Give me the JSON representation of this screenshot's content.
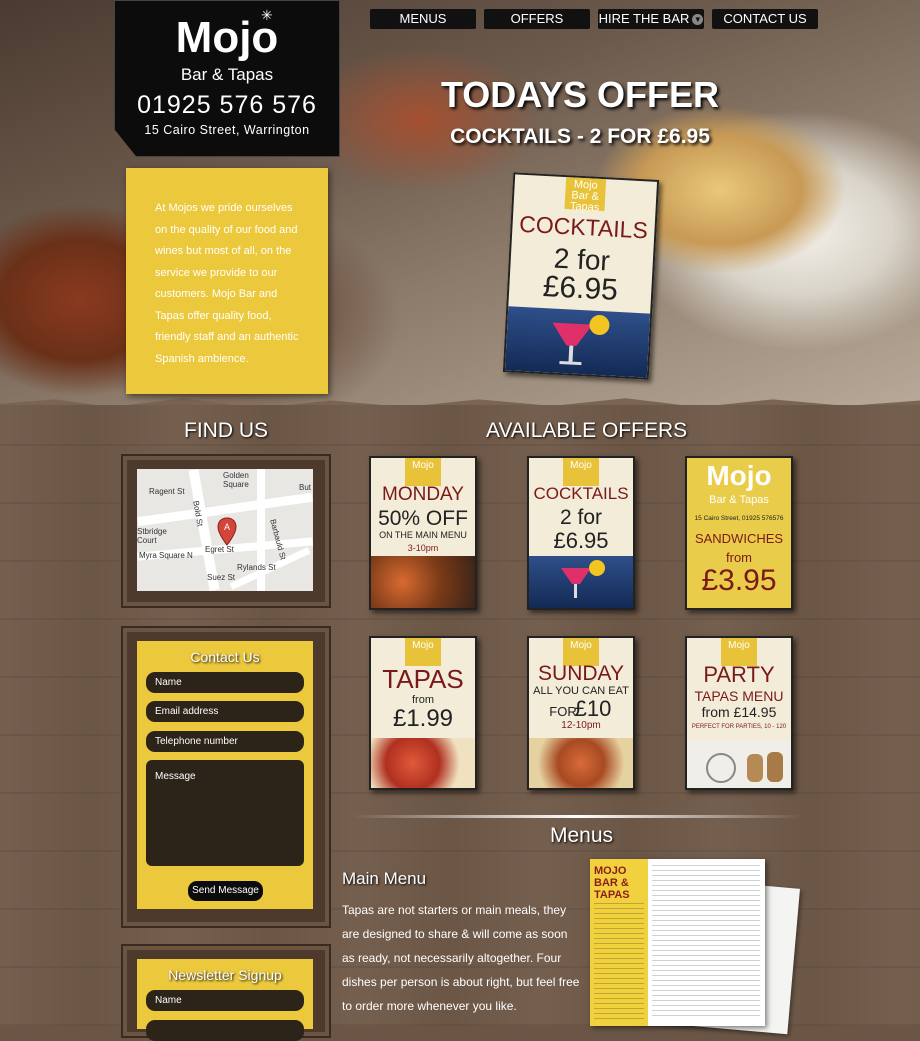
{
  "logo": {
    "name": "Mojo",
    "sub": "Bar & Tapas",
    "phone": "01925 576 576",
    "address": "15 Cairo Street, Warrington"
  },
  "nav": {
    "items": [
      "MENUS",
      "OFFERS",
      "HIRE THE BAR",
      "CONTACT US"
    ]
  },
  "hero": {
    "title": "TODAYS OFFER",
    "subtitle": "COCKTAILS - 2 FOR £6.95"
  },
  "intro": {
    "text": "At Mojos we pride ourselves on the quality of our food and wines but most of all, on the service we provide to our customers. Mojo Bar and Tapas offer quality food, friendly staff and an authentic Spanish ambience."
  },
  "featured_poster": {
    "logo": "Mojo Bar & Tapas",
    "line1": "COCKTAILS",
    "line2": "2 for",
    "line3": "£6.95"
  },
  "find_us": {
    "title": "FIND US",
    "map_labels": [
      "Golden Square",
      "Ragent St",
      "Bold St",
      "Egret St",
      "Suez St",
      "Rylands St",
      "Barbauld St",
      "Myra Square N",
      "Stbridge Court",
      "But"
    ],
    "marker": "A"
  },
  "contact": {
    "title": "Contact Us",
    "name_placeholder": "Name",
    "email_placeholder": "Email address",
    "phone_placeholder": "Telephone number",
    "message_placeholder": "Message",
    "send": "Send Message"
  },
  "newsletter": {
    "title": "Newsletter Signup",
    "name_placeholder": "Name"
  },
  "offers": {
    "title": "AVAILABLE OFFERS",
    "cards": [
      {
        "logo": "Mojo",
        "lines": [
          "MONDAY",
          "50% OFF",
          "ON THE MAIN MENU",
          "3-10pm"
        ]
      },
      {
        "logo": "Mojo",
        "lines": [
          "COCKTAILS",
          "2 for",
          "£6.95"
        ]
      },
      {
        "logo": "Mojo",
        "lines": [
          "Bar & Tapas",
          "15 Cairo Street, 01925 576576",
          "SANDWICHES",
          "from",
          "£3.95"
        ]
      },
      {
        "logo": "Mojo",
        "lines": [
          "TAPAS",
          "from",
          "£1.99"
        ]
      },
      {
        "logo": "Mojo",
        "lines": [
          "SUNDAY",
          "ALL YOU CAN EAT",
          "FOR",
          "£10",
          "12-10pm"
        ]
      },
      {
        "logo": "Mojo",
        "lines": [
          "PARTY",
          "TAPAS MENU",
          "from £14.95",
          "PERFECT FOR PARTIES, 10 - 120"
        ]
      }
    ]
  },
  "menus": {
    "title": "Menus",
    "heading": "Main Menu",
    "text": "Tapas are not starters or main meals, they are designed to share & will come as soon as ready, not necessarily altogether. Four dishes per person is about right, but feel free to order more whenever you like.",
    "thumb_title": "MOJO BAR & TAPAS"
  }
}
